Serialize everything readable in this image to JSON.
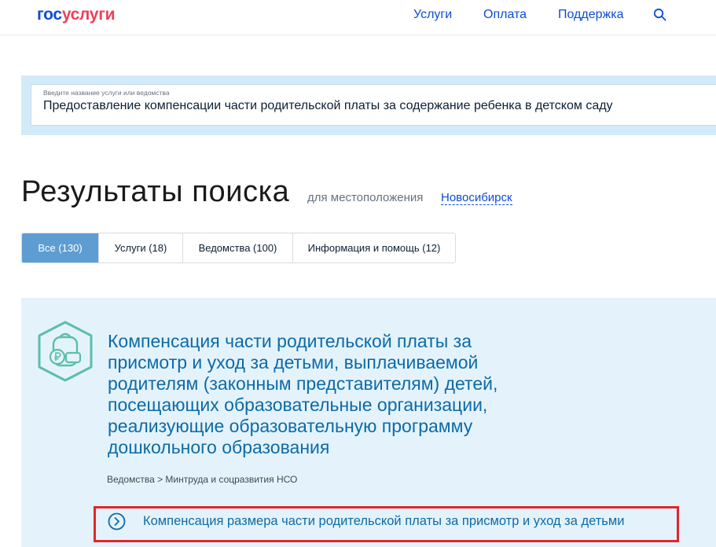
{
  "header": {
    "logo": {
      "part1": "гос",
      "part2": "услуги"
    },
    "nav": [
      "Услуги",
      "Оплата",
      "Поддержка"
    ],
    "search_icon": "search-icon"
  },
  "search": {
    "label": "Введите название услуги или ведомства",
    "value": "Предоставление компенсации части родительской платы за содержание ребенка в детском саду"
  },
  "results": {
    "title": "Результаты поиска",
    "location_label": "для местоположения",
    "location_value": "Новосибирск"
  },
  "tabs": [
    {
      "label": "Все (130)",
      "active": true
    },
    {
      "label": "Услуги (18)",
      "active": false
    },
    {
      "label": "Ведомства (100)",
      "active": false
    },
    {
      "label": "Информация и помощь (12)",
      "active": false
    }
  ],
  "result_card": {
    "icon": "backpack-ruble-icon",
    "title": "Компенсация части родительской платы за присмотр и уход за детьми, выплачиваемой родителям (законным представителям) детей, посещающих образовательные организации, реализующие образовательную программу дошкольного образования",
    "breadcrumb": "Ведомства > Минтруда и соцразвития НСО",
    "subservice": {
      "icon": "chevron-right-circle-icon",
      "label": "Компенсация размера части родительской платы за присмотр и уход за детьми"
    }
  },
  "colors": {
    "brand_blue": "#0d4cd3",
    "brand_red": "#ee3f58",
    "link_blue": "#0d6aa8",
    "tab_active": "#5e9dd2",
    "search_band": "#d3eaf8",
    "card_bg": "#e4f3fb",
    "icon_teal": "#5cbfa8",
    "highlight_red": "#e0262d"
  }
}
